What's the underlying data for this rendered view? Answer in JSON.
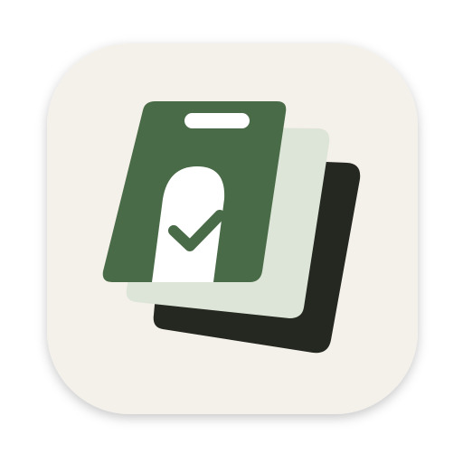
{
  "app_icon": {
    "icon_name": "stacked-cards-checkmark-app-icon",
    "colors": {
      "tile_background": "#F4F0EA",
      "back_card": "#252820",
      "middle_card": "#DDE5D8",
      "front_card": "#4A6B47",
      "front_card_cutout": "#FFFFFF",
      "slot": "#FFFFFF",
      "checkmark": "#4A6B47"
    }
  }
}
